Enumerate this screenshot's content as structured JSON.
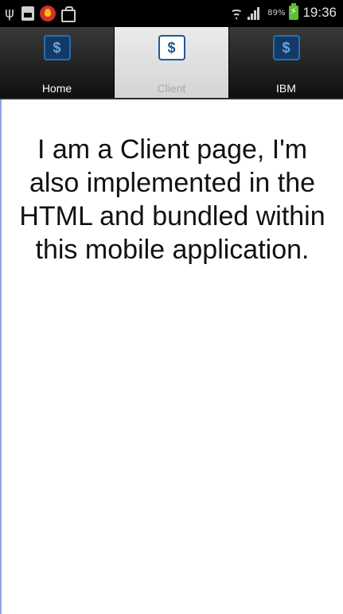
{
  "status_bar": {
    "battery_percent": "89%",
    "time": "19:36",
    "icons": [
      "usb-icon",
      "sim-icon",
      "app-icon",
      "shopping-bag-icon",
      "wifi-icon",
      "signal-icon",
      "battery-charging-icon"
    ]
  },
  "tabs": [
    {
      "label": "Home",
      "icon": "dollar-icon",
      "active": false
    },
    {
      "label": "Client",
      "icon": "dollar-icon",
      "active": true
    },
    {
      "label": "IBM",
      "icon": "dollar-icon",
      "active": false
    }
  ],
  "tab_icon_glyph": "$",
  "content": {
    "message": "I am a Client page, I'm also implemented in the HTML and bundled within this mobile application."
  },
  "colors": {
    "status_bar_bg": "#000000",
    "tab_active_bg": "#e0e0e0",
    "tab_inactive_bg": "#1a1a1a",
    "icon_blue": "#1e5a9a",
    "content_border": "#8fa6e6"
  }
}
